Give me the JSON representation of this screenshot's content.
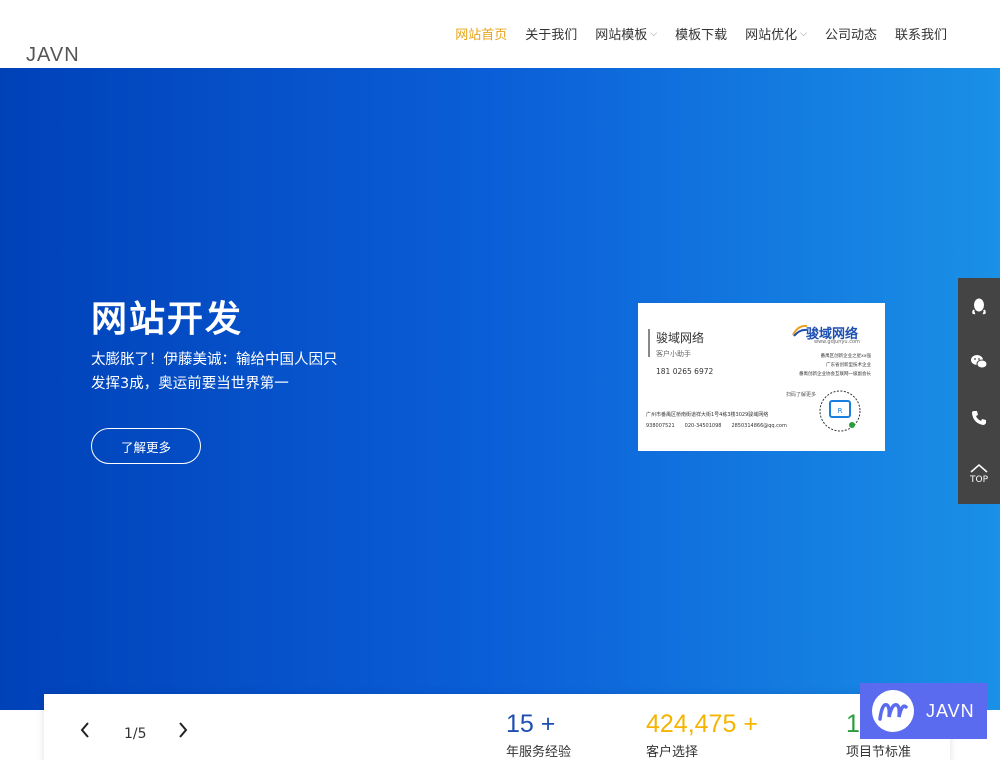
{
  "logo": "JAVN",
  "nav": [
    {
      "label": "网站首页",
      "active": true,
      "dropdown": false
    },
    {
      "label": "关于我们",
      "active": false,
      "dropdown": false
    },
    {
      "label": "网站模板",
      "active": false,
      "dropdown": true
    },
    {
      "label": "模板下载",
      "active": false,
      "dropdown": false
    },
    {
      "label": "网站优化",
      "active": false,
      "dropdown": true
    },
    {
      "label": "公司动态",
      "active": false,
      "dropdown": false
    },
    {
      "label": "联系我们",
      "active": false,
      "dropdown": false
    }
  ],
  "hero": {
    "title": "网站开发",
    "subtitle": "太膨胀了！伊藤美诚：输给中国人因只发挥3成，奥运前要当世界第一",
    "button": "了解更多"
  },
  "card": {
    "name": "骏域网络",
    "role": "客户小助手",
    "phone": "181 0265 6972",
    "brand": "骏域网络",
    "url": "www.gdjunyu.com",
    "lines": [
      "番禺区创新企业之星xx强",
      "广东省创新型技术企业",
      "番禺创新企业协会互联网一级副会长"
    ],
    "scan": "扫码了解更多",
    "address": "广州市番禺区桥南街道祥大街1号4栋3楼3029骏域网络",
    "qq": "938007521",
    "tel": "020-34501098",
    "email": "2850314866@qq.com"
  },
  "side": {
    "icons": [
      "qq-icon",
      "wechat-icon",
      "phone-icon"
    ],
    "top_label": "TOP"
  },
  "slider": {
    "current": "1",
    "total": "5",
    "counter": "1/5"
  },
  "stats": [
    {
      "number": "15 +",
      "label": "年服务经验",
      "color": "#1d4fb0"
    },
    {
      "number": "424,475 +",
      "label": "客户选择",
      "color": "#f5b400"
    },
    {
      "number": "1",
      "label": "项目节标准",
      "color": "#2a9d3a"
    }
  ],
  "watermark": "JAVN",
  "colors": {
    "accent": "#e8a317",
    "hero_start": "#0041b8",
    "hero_end": "#1a90e6",
    "side": "#444444"
  }
}
